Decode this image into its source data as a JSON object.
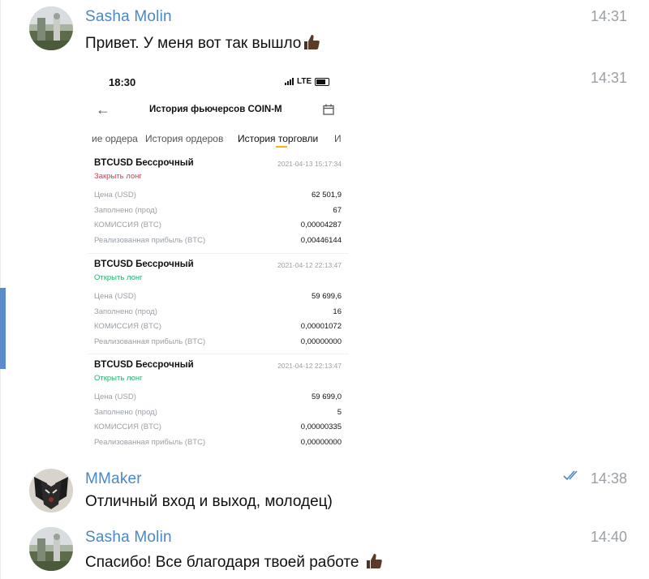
{
  "messages": [
    {
      "sender": "Sasha Molin",
      "time": "14:31",
      "text": "Привет. У меня вот так вышло",
      "emoji": "thumbs-up"
    },
    {
      "time": "14:31",
      "screenshot": {
        "status_time": "18:30",
        "carrier": "LTE",
        "title": "История фьючерсов COIN-M",
        "tabs": [
          "ие ордера",
          "История ордеров",
          "История торговли",
          "И"
        ],
        "active_tab": "История торговли",
        "trades": [
          {
            "name": "BTCUSD Бессрочный",
            "datetime": "2021-04-13 15:17:34",
            "side": "Закрыть лонг",
            "side_color": "#e0394f",
            "rows": [
              {
                "label": "Цена (USD)",
                "value": "62 501,9"
              },
              {
                "label": "Заполнено (прод)",
                "value": "67"
              },
              {
                "label": "КОМИССИЯ (BTC)",
                "value": "0,00004287"
              },
              {
                "label": "Реализованная прибыль (BTC)",
                "value": "0,00446144"
              }
            ]
          },
          {
            "name": "BTCUSD Бессрочный",
            "datetime": "2021-04-12 22:13:47",
            "side": "Открыть лонг",
            "side_color": "#20b26c",
            "rows": [
              {
                "label": "Цена (USD)",
                "value": "59 699,6"
              },
              {
                "label": "Заполнено (прод)",
                "value": "16"
              },
              {
                "label": "КОМИССИЯ (BTC)",
                "value": "0,00001072"
              },
              {
                "label": "Реализованная прибыль (BTC)",
                "value": "0,00000000"
              }
            ]
          },
          {
            "name": "BTCUSD Бессрочный",
            "datetime": "2021-04-12 22:13:47",
            "side": "Открыть лонг",
            "side_color": "#20b26c",
            "rows": [
              {
                "label": "Цена (USD)",
                "value": "59 699,0"
              },
              {
                "label": "Заполнено (прод)",
                "value": "5"
              },
              {
                "label": "КОМИССИЯ (BTC)",
                "value": "0,00000335"
              },
              {
                "label": "Реализованная прибыль (BTC)",
                "value": "0,00000000"
              }
            ]
          }
        ]
      }
    },
    {
      "sender": "MMaker",
      "time": "14:38",
      "read": true,
      "text": "Отличный вход и выход, молодец)"
    },
    {
      "sender": "Sasha Molin",
      "time": "14:40",
      "text": "Спасибо! Все благодаря твоей работе",
      "emoji": "thumbs-up"
    }
  ],
  "colors": {
    "sender_name": "#4a88c5",
    "timestamp": "#9aa0a6",
    "read_checks": "#4a88c5",
    "left_accent": "#5b8bc9"
  }
}
